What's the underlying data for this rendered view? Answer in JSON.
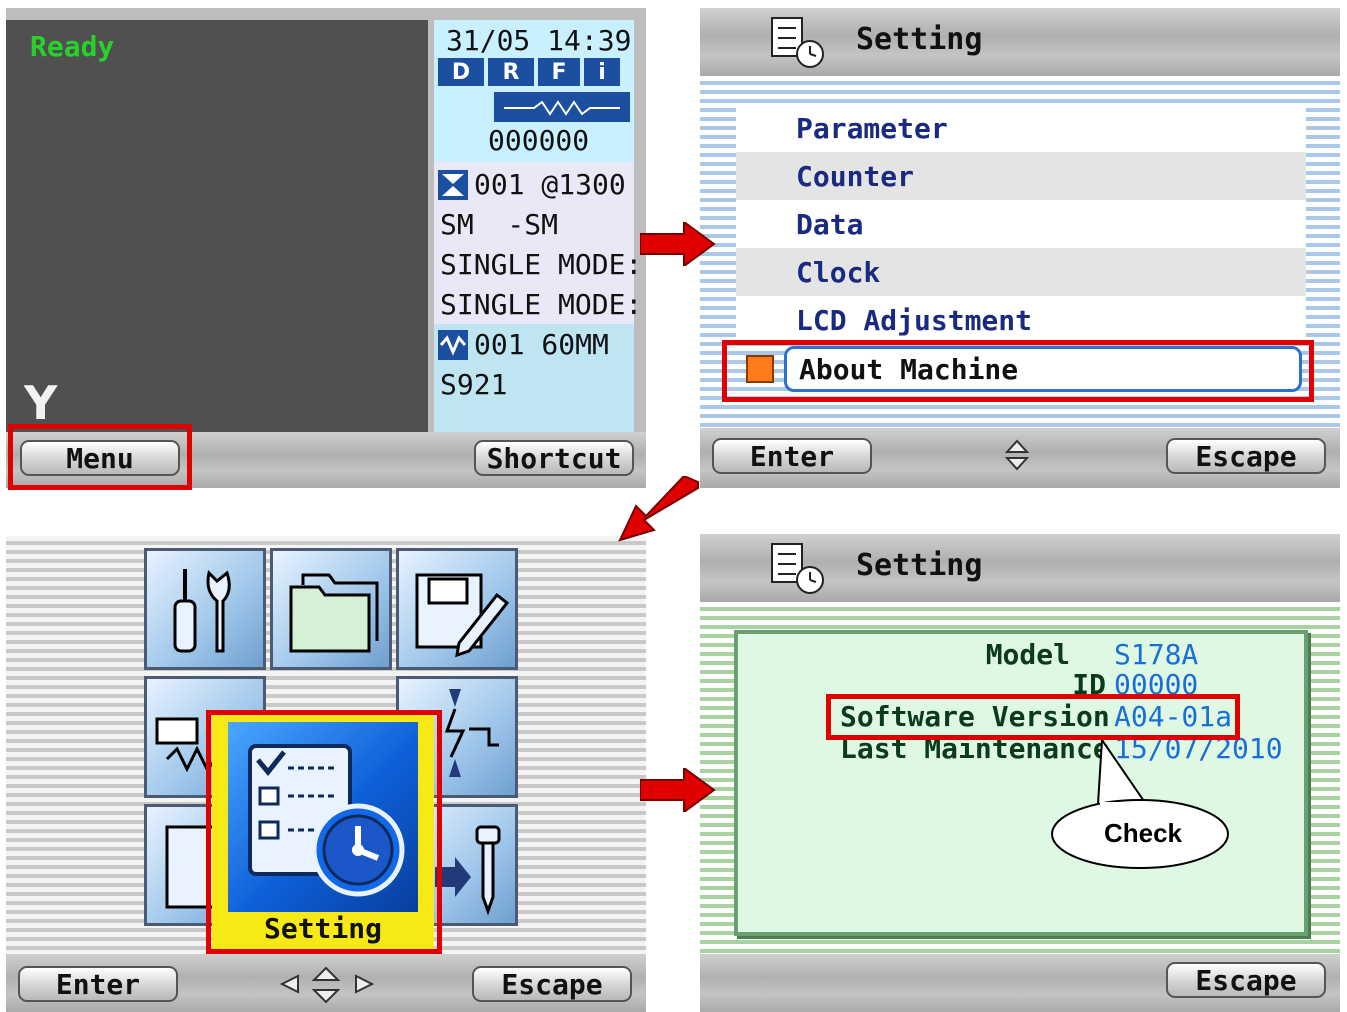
{
  "panel1": {
    "status": "Ready",
    "datetime": "31/05 14:39",
    "mode_icons": [
      "D",
      "R",
      "F",
      "i"
    ],
    "counter": "000000",
    "program_line": "001 @1300",
    "splice_mode": "SM  -SM",
    "line3": "SINGLE MODE:",
    "line4": "SINGLE MODE:",
    "heater_line": "001 60MM",
    "heater_code": "S921",
    "bottom_icon": "Y",
    "menu_button": "Menu",
    "shortcut_button": "Shortcut",
    "colors": {
      "ready": "#27d32b",
      "info_bg": "#c9f0ff",
      "list_bg": "#e8e8f7"
    }
  },
  "panel2": {
    "title": "Setting",
    "items": [
      {
        "label": "Parameter"
      },
      {
        "label": "Counter"
      },
      {
        "label": "Data"
      },
      {
        "label": "Clock"
      },
      {
        "label": "LCD Adjustment"
      },
      {
        "label": "About Machine",
        "selected": true
      }
    ],
    "enter_button": "Enter",
    "escape_button": "Escape"
  },
  "panel3": {
    "selected_label": "Setting",
    "enter_button": "Enter",
    "escape_button": "Escape",
    "tiles": [
      "tools-icon",
      "folder-icon",
      "save-edit-icon",
      "splice-icon",
      "setting-icon",
      "arc-icon",
      "heater-icon",
      "nail-icon"
    ]
  },
  "panel4": {
    "title": "Setting",
    "model_label": "Model",
    "model_value": "S178A",
    "id_label": "ID",
    "id_value": "00000",
    "software_label": "Software Version",
    "software_value": "A04-01a",
    "maint_label": "Last Maintenance",
    "maint_value": "15/07/2010",
    "check_callout": "Check",
    "escape_button": "Escape"
  },
  "colors": {
    "highlight": "#e00000",
    "accent_blue": "#1a6fd6",
    "label_green": "#0b3b1a"
  }
}
